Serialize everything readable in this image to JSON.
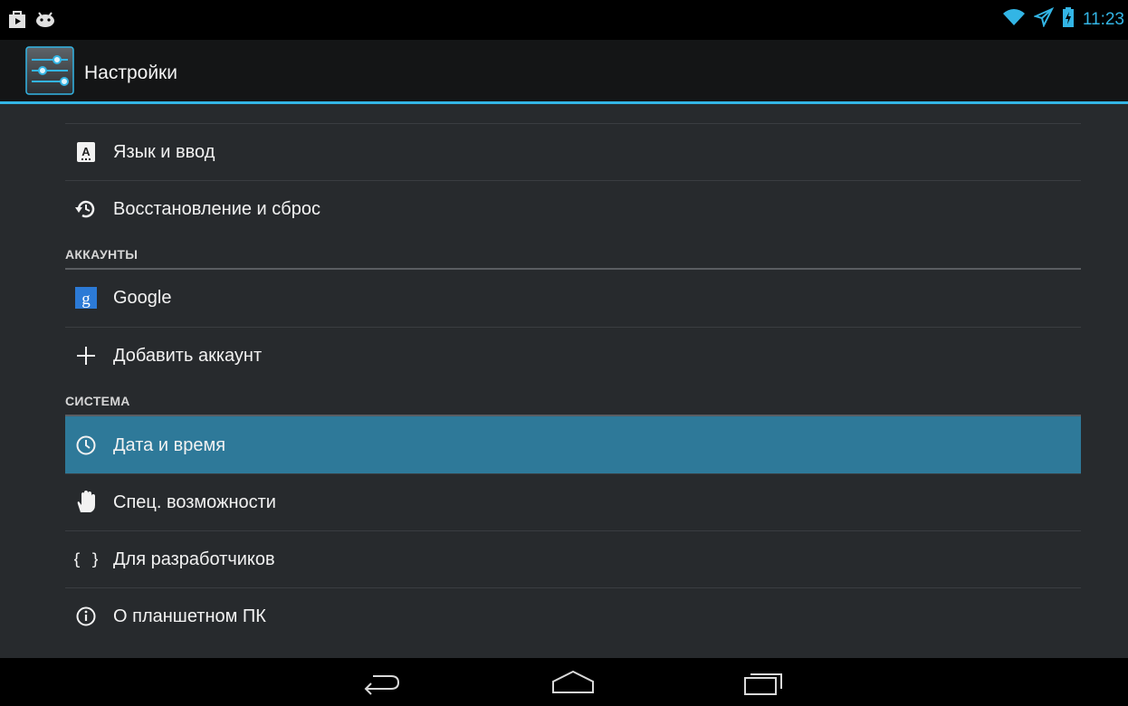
{
  "status_bar": {
    "left_icons": [
      "shopping-bag-icon",
      "android-icon"
    ],
    "right_icons": [
      "wifi-icon",
      "airplane-mode-icon",
      "battery-charging-icon"
    ],
    "time": "11:23"
  },
  "action_bar": {
    "title": "Настройки",
    "icon": "settings-sliders-icon"
  },
  "list": {
    "language": {
      "label": "Язык и ввод",
      "icon": "keyboard-a-icon"
    },
    "backup": {
      "label": "Восстановление и сброс",
      "icon": "restore-icon"
    },
    "accounts_header": "АККАУНТЫ",
    "google": {
      "label": "Google",
      "icon": "google-icon"
    },
    "add_account": {
      "label": "Добавить аккаунт",
      "icon": "plus-icon"
    },
    "system_header": "СИСТЕМА",
    "date_time": {
      "label": "Дата и время",
      "icon": "clock-icon",
      "selected": true
    },
    "accessibility": {
      "label": "Спец. возможности",
      "icon": "hand-icon"
    },
    "developer": {
      "label": "Для разработчиков",
      "icon": "braces-icon"
    },
    "about": {
      "label": "О планшетном ПК",
      "icon": "info-icon"
    }
  },
  "nav_bar": {
    "buttons": [
      "back-icon",
      "home-icon",
      "recent-apps-icon"
    ]
  },
  "colors": {
    "accent": "#33b5e5",
    "selected_row": "#2e7999",
    "background": "#272a2d"
  }
}
